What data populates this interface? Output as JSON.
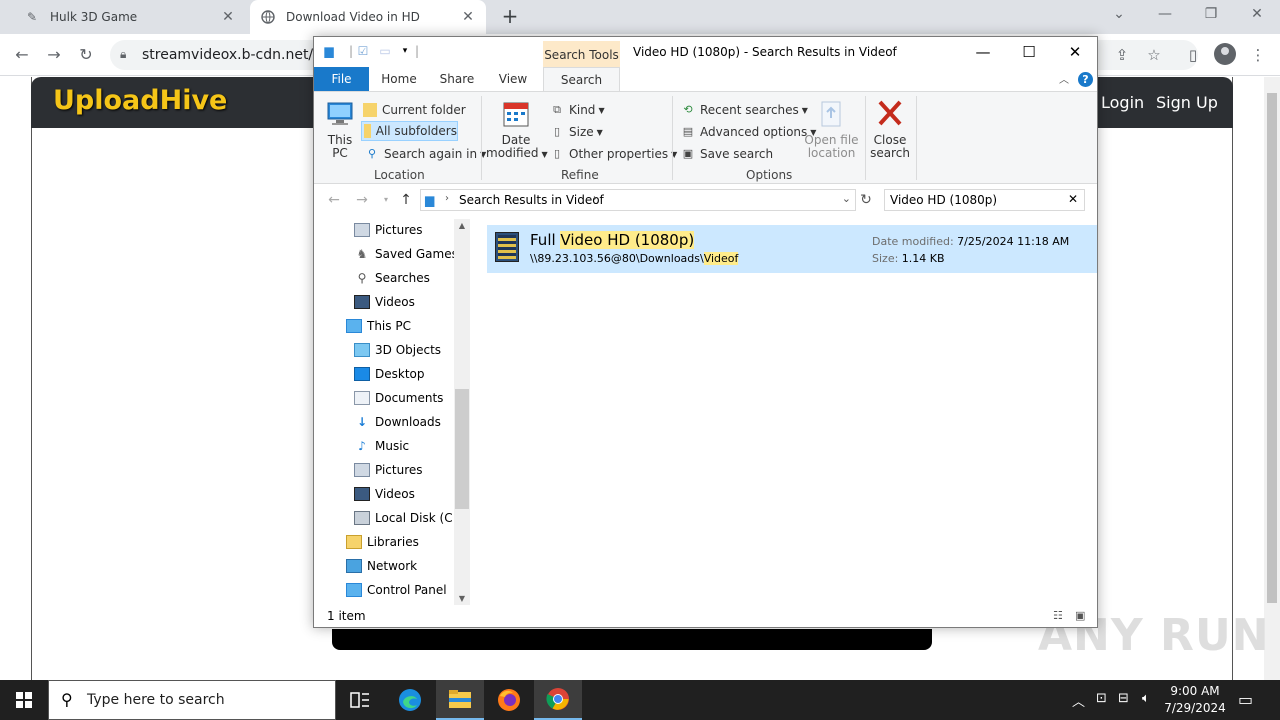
{
  "browser": {
    "tabs": [
      {
        "title": "Hulk 3D Game",
        "active": false
      },
      {
        "title": "Download Video in HD",
        "active": true
      }
    ],
    "url": "streamvideox.b-cdn.net/HD-"
  },
  "site": {
    "logo": "UploadHive",
    "nav": {
      "login": "Login",
      "signup": "Sign Up"
    },
    "watermark": "ANY RUN"
  },
  "explorer": {
    "contextual_tab": "Search Tools",
    "title": "Video HD (1080p) - Search Results in Videof",
    "ribbon_tabs": {
      "file": "File",
      "home": "Home",
      "share": "Share",
      "view": "View",
      "search": "Search"
    },
    "location": {
      "this_pc_line1": "This",
      "this_pc_line2": "PC",
      "current_folder": "Current folder",
      "all_subfolders": "All subfolders",
      "search_again_in": "Search again in",
      "group": "Location"
    },
    "refine": {
      "date_modified_line1": "Date",
      "date_modified_line2": "modified",
      "kind": "Kind",
      "size": "Size",
      "other_properties": "Other properties",
      "group": "Refine"
    },
    "options": {
      "recent_searches": "Recent searches",
      "advanced_options": "Advanced options",
      "save_search": "Save search",
      "open_file_location_line1": "Open file",
      "open_file_location_line2": "location",
      "close_search_line1": "Close",
      "close_search_line2": "search",
      "group": "Options"
    },
    "address": {
      "breadcrumb": "Search Results in Videof"
    },
    "search_value": "Video HD (1080p)",
    "nav_items": [
      "Pictures",
      "Saved Games",
      "Searches",
      "Videos",
      "This PC",
      "3D Objects",
      "Desktop",
      "Documents",
      "Downloads",
      "Music",
      "Pictures",
      "Videos",
      "Local Disk (C:)",
      "Libraries",
      "Network",
      "Control Panel"
    ],
    "result": {
      "title_prefix": "Full ",
      "title_highlight": "Video HD (1080p)",
      "path_prefix": "\\\\89.23.103.56@80\\Downloads\\",
      "path_highlight": "Videof",
      "date_label": "Date modified:",
      "date_value": "7/25/2024 11:18 AM",
      "size_label": "Size:",
      "size_value": "1.14 KB"
    },
    "status": "1 item"
  },
  "taskbar": {
    "search_placeholder": "Type here to search",
    "time": "9:00 AM",
    "date": "7/29/2024"
  },
  "colors": {
    "accent": "#1979ca",
    "selection": "#cce8ff",
    "highlight": "#ffec8b",
    "site_header": "#2c2f33",
    "logo": "#f5c518"
  }
}
